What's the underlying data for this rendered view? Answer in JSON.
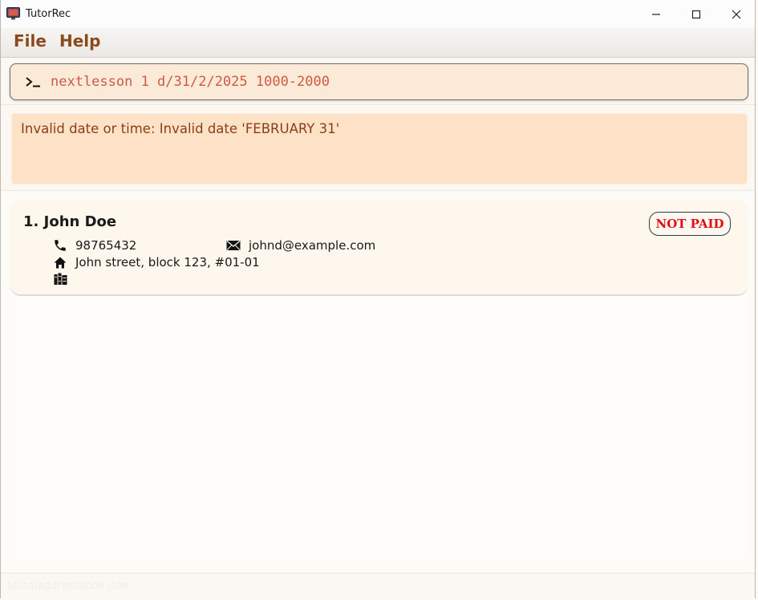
{
  "window": {
    "title": "TutorRec",
    "icon": "app-icon"
  },
  "menu": {
    "file_label": "File",
    "help_label": "Help"
  },
  "command": {
    "value": "nextlesson 1 d/31/2/2025 1000-2000",
    "prompt_icon": "terminal-prompt-icon"
  },
  "result": {
    "message": "Invalid date or time: Invalid date 'FEBRUARY 31'"
  },
  "persons": [
    {
      "index_name": "1. John Doe",
      "payment_status": "NOT PAID",
      "phone": "98765432",
      "email": "johnd@example.com",
      "address": "John street, block 123, #01-01",
      "lessons": ""
    }
  ],
  "status": {
    "path": "\\data\\addressbook.json"
  },
  "colors": {
    "accent": "#8b4a1c",
    "command_text": "#cd5a43",
    "command_bg": "#fcead8",
    "result_bg": "#fde2c7",
    "not_paid": "#e01010"
  }
}
